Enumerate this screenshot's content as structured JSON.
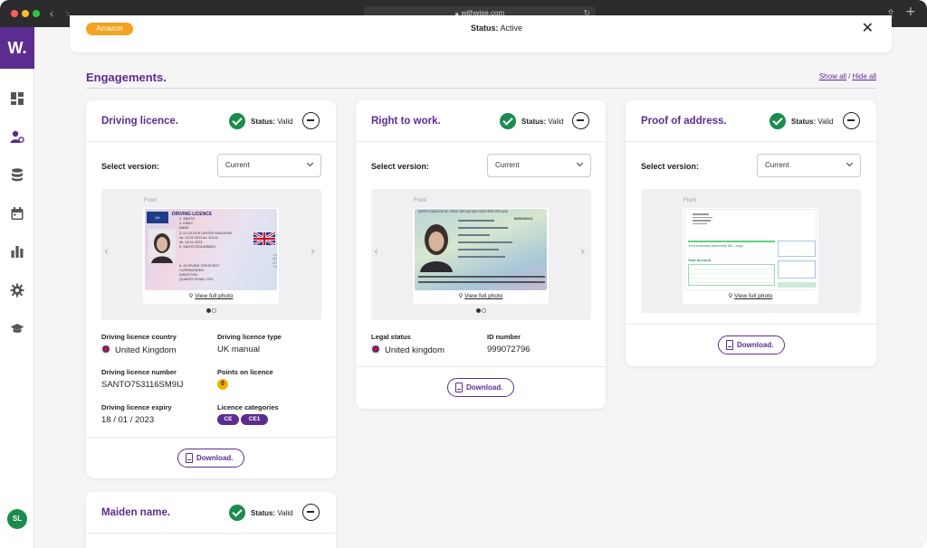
{
  "browser": {
    "url": "withwise.com",
    "lock_icon": "lock-icon",
    "reload_icon": "reload-icon",
    "share_icon": "share-icon",
    "new_tab_icon": "plus-icon",
    "back_icon": "chevron-left-icon",
    "forward_icon": "chevron-right-icon"
  },
  "sidebar": {
    "logo": "W.",
    "items": [
      {
        "icon": "dashboard-icon"
      },
      {
        "icon": "user-settings-icon"
      },
      {
        "icon": "database-icon"
      },
      {
        "icon": "calendar-icon"
      },
      {
        "icon": "bar-chart-icon"
      },
      {
        "icon": "gear-icon"
      },
      {
        "icon": "graduation-cap-icon"
      }
    ],
    "avatar_initials": "SL"
  },
  "top_card": {
    "badge": "Amazon",
    "status_label": "Status:",
    "status_value": "Active",
    "close_glyph": "✕"
  },
  "engagements": {
    "title": "Engagements.",
    "show_all": "Show all",
    "separator": "/",
    "hide_all": "Hide all"
  },
  "cards": {
    "driving": {
      "title": "Driving licence.",
      "status_label": "Status:",
      "status_value": "Valid",
      "select_label": "Select version:",
      "version": "Current",
      "front_label": "Front",
      "view_full": "View full photo",
      "licence_header": "DRIVING LICENCE",
      "licence_country_code": "UK",
      "licence_lines": [
        "1. SANTO",
        "2. EMILY",
        "ANNE",
        "3. 01.03.1976 UNITED KINGDOM",
        "4a. 19.01.2013  4c. DVLA",
        "4b. 18.01.2023",
        "5. SANTO753116SM9IJ"
      ],
      "licence_address": [
        "8. 26 IRVING CRESCENT",
        "CURRAGHEEN",
        "KINGSTON",
        "QUARRY ROAD, FE3"
      ],
      "licence_side": "TEST",
      "fields": {
        "country_label": "Driving licence country",
        "country_value": "United Kingdom",
        "type_label": "Driving licence type",
        "type_value": "UK manual",
        "number_label": "Driving licence number",
        "number_value": "SANTO753116SM9IJ",
        "points_label": "Points on licence",
        "points_value": "0",
        "expiry_label": "Driving licence expiry",
        "expiry_value": "18 / 01 / 2023",
        "categories_label": "Licence categories",
        "categories": [
          "CE",
          "CE1"
        ]
      },
      "download": "Download.",
      "pages_total": 2,
      "page_current": 1
    },
    "rtw": {
      "title": "Right to work.",
      "status_label": "Status:",
      "status_value": "Valid",
      "select_label": "Select version:",
      "version": "Current",
      "front_label": "Front",
      "view_full": "View full photo",
      "passport_header": "UNITED KINGDOM OF GREAT BRITAIN AND NORTHERN IRELAND",
      "passport_number": "6051040C1",
      "fields": {
        "legal_label": "Legal status",
        "legal_value": "United kingdom",
        "id_label": "ID number",
        "id_value": "999072796"
      },
      "download": "Download.",
      "pages_total": 2,
      "page_current": 1
    },
    "poa": {
      "title": "Proof of address.",
      "status_label": "Status:",
      "status_value": "Valid",
      "select_label": "Select version:",
      "version": "Current",
      "front_label": "Front",
      "view_full": "View full photo",
      "bill_heading": "Your business electricity bill - copy",
      "bill_account": "Your account",
      "download": "Download."
    },
    "maiden": {
      "title": "Maiden name.",
      "status_label": "Status:",
      "status_value": "Valid"
    }
  },
  "colors": {
    "brand": "#5c2d91",
    "valid": "#1a8c4e",
    "amazon": "#f4a321",
    "points": "#f4b000"
  }
}
